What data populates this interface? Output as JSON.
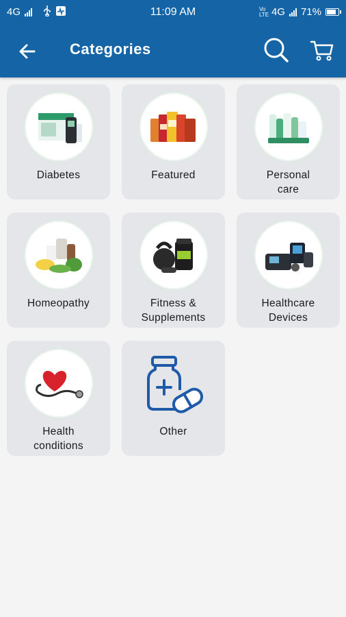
{
  "status_bar": {
    "network_left": "4G",
    "time": "11:09 AM",
    "volte": "Vo LTE",
    "network_right": "4G",
    "battery": "71%"
  },
  "app_bar": {
    "title": "Categories",
    "back_icon": "arrow-back-icon",
    "search_icon": "search-icon",
    "cart_icon": "cart-icon"
  },
  "colors": {
    "primary": "#1565a6",
    "card_bg": "#e5e6ea",
    "page_bg": "#f4f4f5",
    "icon_blue": "#1e5aa8"
  },
  "categories": [
    {
      "line1": "Diabetes",
      "line2": "",
      "image": "glucometer-kit"
    },
    {
      "line1": "Featured",
      "line2": "",
      "image": "health-drink-jars"
    },
    {
      "line1": "Personal",
      "line2": "care",
      "image": "personal-care-products"
    },
    {
      "line1": "Homeopathy",
      "line2": "",
      "image": "herbs-and-bottles"
    },
    {
      "line1": "Fitness &",
      "line2": "Supplements",
      "image": "kettlebell-and-supplement"
    },
    {
      "line1": "Healthcare",
      "line2": "Devices",
      "image": "medical-devices"
    },
    {
      "line1": "Health",
      "line2": "conditions",
      "image": "heart-stethoscope"
    },
    {
      "line1": "Other",
      "line2": "",
      "image": "medicine-bottle-pill-icon"
    }
  ]
}
